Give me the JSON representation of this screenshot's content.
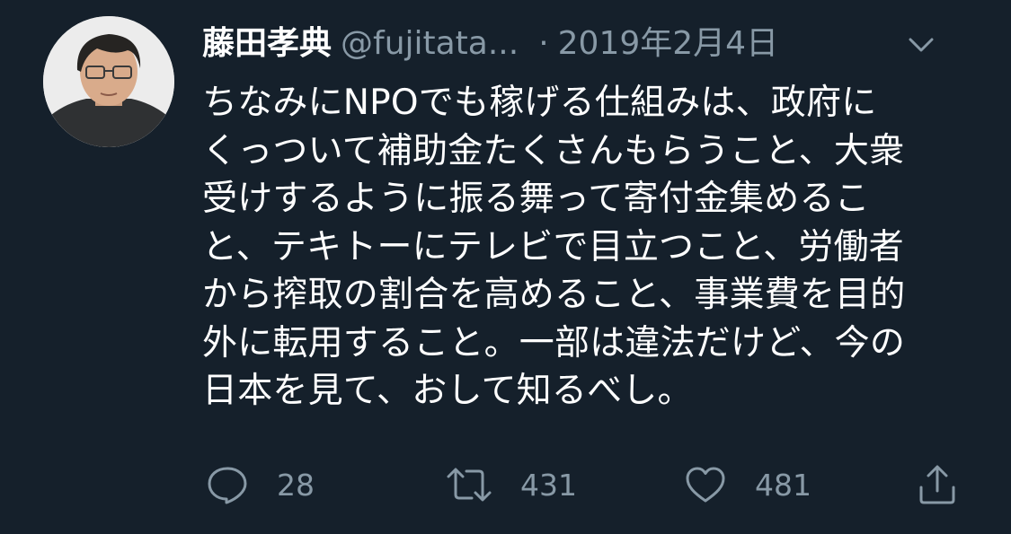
{
  "user": {
    "display_name": "藤田孝典",
    "handle": "@fujitata...",
    "separator": "·",
    "date": "2019年2月4日"
  },
  "icons": {
    "avatar": "user-avatar-photo",
    "caret": "chevron-down-icon",
    "reply": "speech-bubble-icon",
    "retweet": "retweet-arrows-icon",
    "like": "heart-icon",
    "share": "share-upload-icon"
  },
  "tweet": {
    "lines": [
      "ちなみにNPOでも稼げる仕組みは、政府に",
      "くっついて補助金たくさんもらうこと、大衆",
      "受けするように振る舞って寄付金集めるこ",
      "と、テキトーにテレビで目立つこと、労働者",
      "から搾取の割合を高めること、事業費を目的",
      "外に転用すること。一部は違法だけど、今の",
      "日本を見て、おして知るべし。"
    ]
  },
  "stats": {
    "replies": "28",
    "retweets": "431",
    "likes": "481"
  },
  "colors": {
    "background": "#15202b",
    "primary_text": "#ffffff",
    "secondary_text": "#8899a6"
  }
}
